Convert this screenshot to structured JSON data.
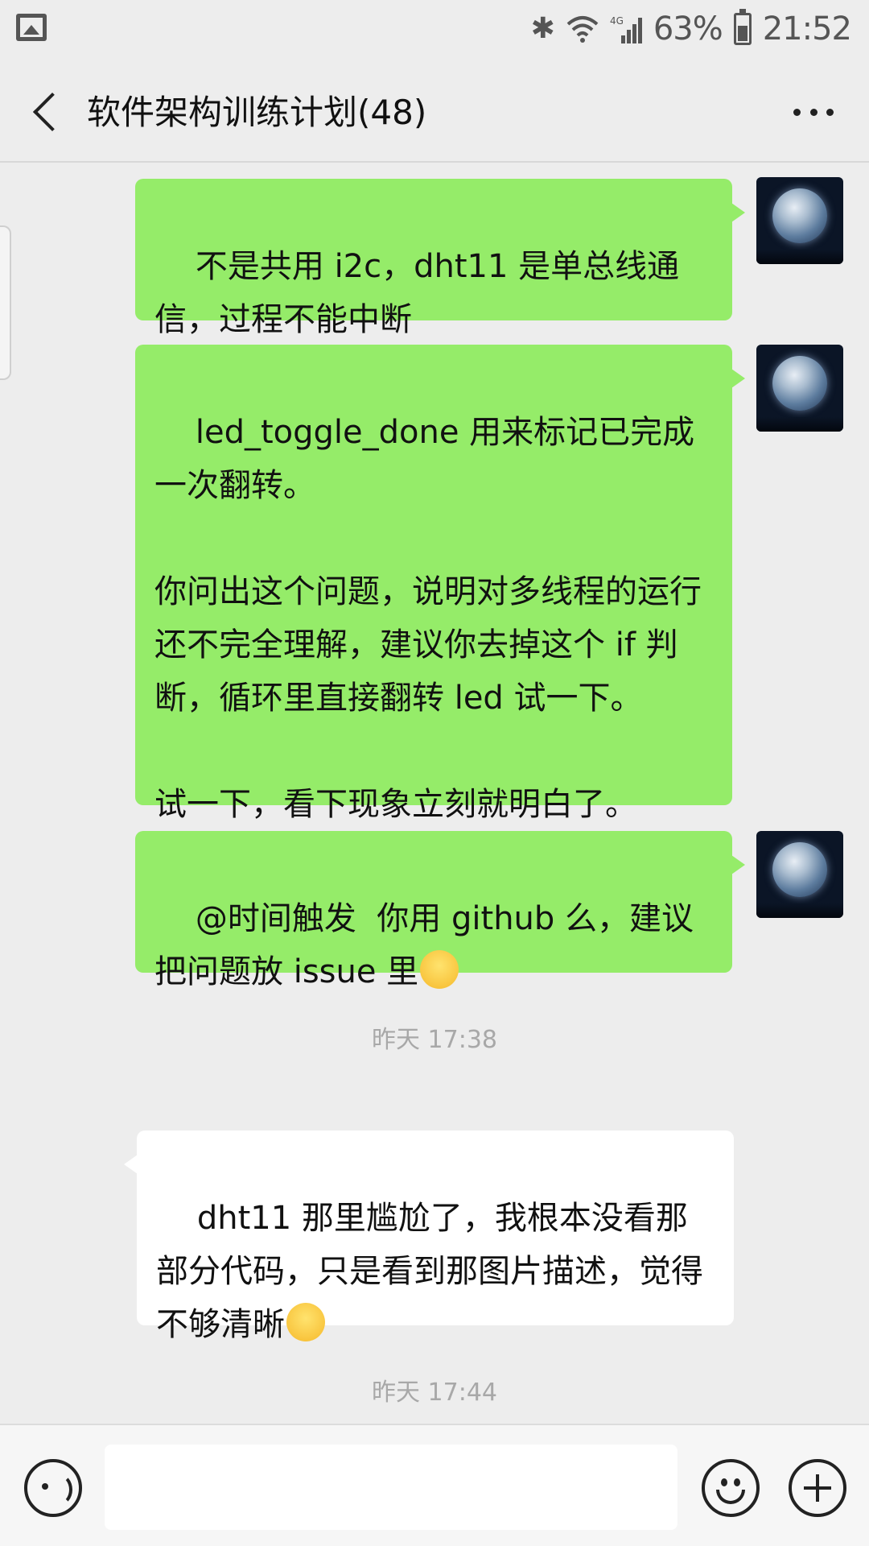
{
  "status_bar": {
    "battery_percent": "63%",
    "network": "4G",
    "time": "21:52",
    "icons": [
      "gallery-icon",
      "bluetooth-icon",
      "wifi-icon",
      "signal-icon",
      "battery-icon"
    ]
  },
  "header": {
    "title": "软件架构训练计划(48)",
    "back_icon": "chevron-left-icon",
    "more_icon": "more-dots-icon"
  },
  "messages": [
    {
      "direction": "outgoing",
      "text": "不是共用 i2c，dht11 是单总线通信，过程不能中断"
    },
    {
      "direction": "outgoing",
      "text": "led_toggle_done 用来标记已完成一次翻转。\n\n你问出这个问题，说明对多线程的运行还不完全理解，建议你去掉这个 if 判断，循环里直接翻转 led 试一下。\n\n试一下，看下现象立刻就明白了。"
    },
    {
      "direction": "outgoing",
      "text": "@时间触发  你用 github 么，建议把问题放 issue 里",
      "emoji": "blush-emoji"
    },
    {
      "direction": "incoming",
      "text": "dht11 那里尴尬了，我根本没看那部分代码，只是看到那图片描述，觉得不够清晰",
      "emoji": "facepalm-emoji"
    }
  ],
  "timestamps": [
    "昨天 17:38",
    "昨天 17:44"
  ],
  "input_bar": {
    "voice_icon": "voice-icon",
    "text_value": "",
    "emoji_icon": "emoji-icon",
    "plus_icon": "plus-icon"
  },
  "colors": {
    "outgoing_bubble": "#95ec69",
    "incoming_bubble": "#ffffff",
    "background": "#ededed"
  }
}
